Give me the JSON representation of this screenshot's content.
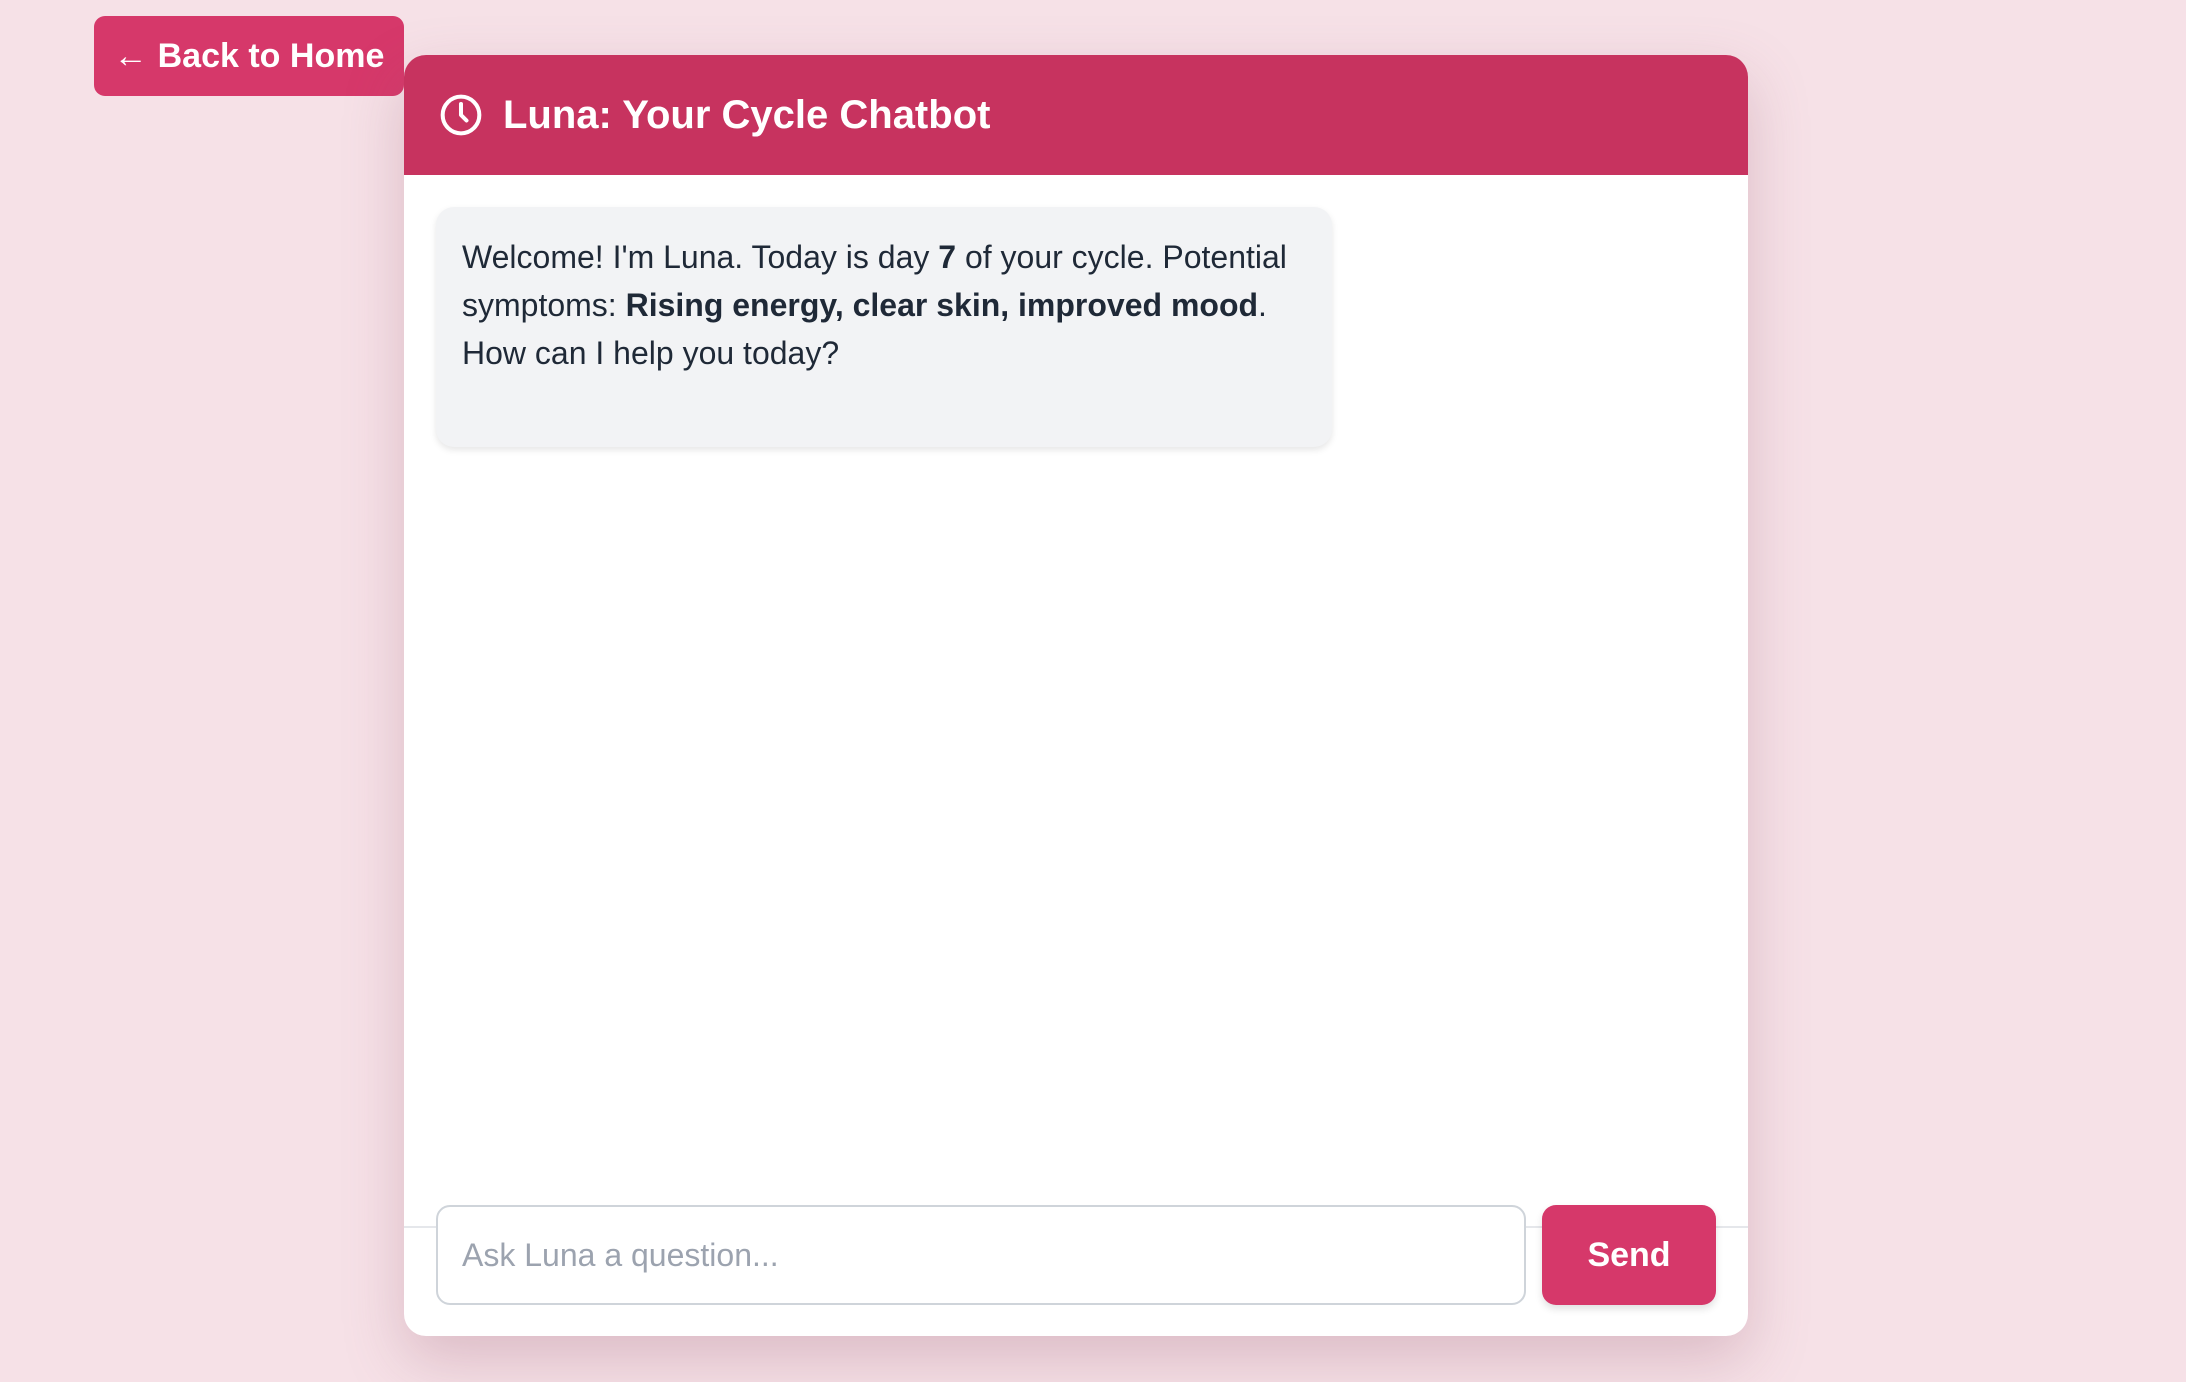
{
  "nav": {
    "back_arrow": "←",
    "back_label": "Back to Home"
  },
  "header": {
    "icon": "clock-icon",
    "title": "Luna: Your Cycle Chatbot"
  },
  "messages": [
    {
      "sender": "Luna",
      "parts": {
        "p1": "Welcome! I'm Luna. Today is day ",
        "day": "7",
        "p2": " of your cycle. Potential symptoms: ",
        "symptoms": "Rising energy, clear skin, improved mood",
        "p3": ". How can I help you today?"
      }
    }
  ],
  "composer": {
    "placeholder": "Ask Luna a question...",
    "value": "",
    "send_label": "Send"
  },
  "colors": {
    "page_background": "#f6e1e7",
    "header": "#c7335f",
    "accent_button": "#d6386a",
    "bubble_background": "#f2f3f5",
    "text": "#1f2937"
  }
}
